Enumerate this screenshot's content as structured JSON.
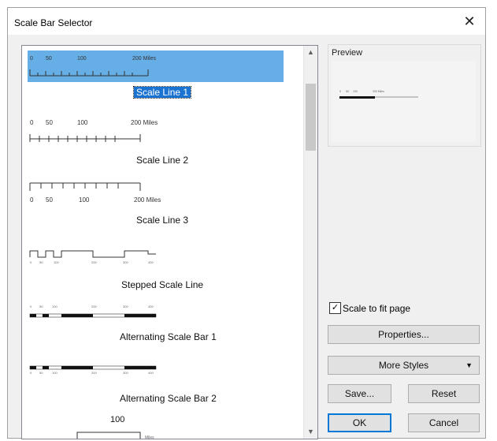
{
  "window": {
    "title": "Scale Bar Selector",
    "close_glyph": "✕"
  },
  "styles": [
    {
      "label": "Scale Line 1",
      "ticks": [
        "0",
        "50",
        "100",
        "200 Miles"
      ],
      "selected": true
    },
    {
      "label": "Scale Line 2",
      "ticks": [
        "0",
        "50",
        "100",
        "200 Miles"
      ]
    },
    {
      "label": "Scale Line 3",
      "ticks": [
        "0",
        "50",
        "100",
        "200 Miles"
      ]
    },
    {
      "label": "Stepped Scale Line"
    },
    {
      "label": "Alternating Scale Bar 1"
    },
    {
      "label": "Alternating Scale Bar 2"
    },
    {
      "label": "",
      "ticks": [
        "100"
      ]
    }
  ],
  "preview": {
    "title": "Preview"
  },
  "scale_to_fit": {
    "label": "Scale to fit page",
    "checked": true
  },
  "buttons": {
    "properties": "Properties...",
    "more_styles": "More Styles",
    "save": "Save...",
    "reset": "Reset",
    "ok": "OK",
    "cancel": "Cancel"
  },
  "colors": {
    "selection": "#66aee6",
    "selected_label": "#1b73d1",
    "default_button_border": "#0078d7"
  },
  "icons": {
    "scroll_up": "chevron-up-icon",
    "scroll_down": "chevron-down-icon",
    "dropdown": "caret-down-icon",
    "close": "close-icon",
    "check": "check-icon"
  }
}
